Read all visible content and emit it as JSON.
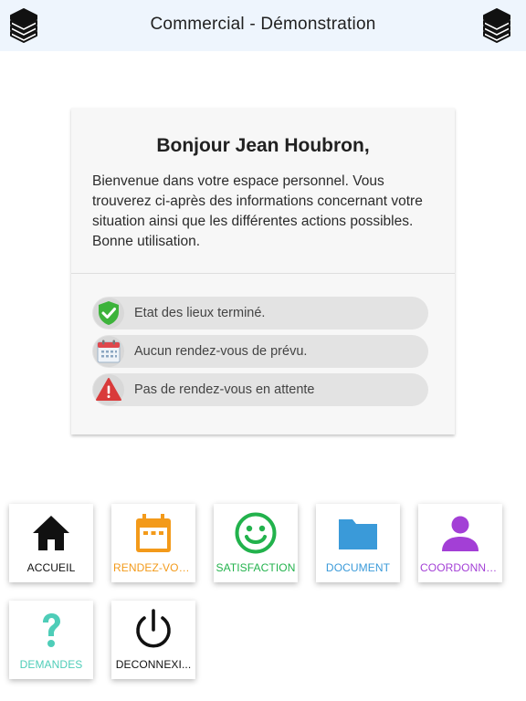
{
  "header": {
    "title": "Commercial - Démonstration",
    "left_icon": "stack-logo-icon",
    "right_icon": "stack-logo-icon"
  },
  "welcome_card": {
    "greeting": "Bonjour Jean Houbron,",
    "message": "Bienvenue dans votre espace personnel. Vous trouverez ci-après des informations concernant votre situation ainsi que les différentes actions possibles. Bonne utilisation.",
    "statuses": [
      {
        "icon": "shield-check-icon",
        "text": "Etat des lieux terminé."
      },
      {
        "icon": "calendar-icon",
        "text": "Aucun rendez-vous de prévu."
      },
      {
        "icon": "warning-icon",
        "text": "Pas de rendez-vous en attente"
      }
    ]
  },
  "menu": [
    {
      "label": "ACCUEIL",
      "icon": "home-icon",
      "color": "#111111"
    },
    {
      "label": "RENDEZ-VOUS",
      "icon": "calendar-icon",
      "color": "#f39a1a"
    },
    {
      "label": "SATISFACTION",
      "icon": "smiley-icon",
      "color": "#22b24c"
    },
    {
      "label": "DOCUMENT",
      "icon": "folder-icon",
      "color": "#3a9ad9"
    },
    {
      "label": "COORDONNE...",
      "icon": "person-icon",
      "color": "#a33fd6"
    },
    {
      "label": "DEMANDES",
      "icon": "question-icon",
      "color": "#4ecdb8"
    },
    {
      "label": "DECONNEXI...",
      "icon": "power-icon",
      "color": "#111111"
    }
  ]
}
